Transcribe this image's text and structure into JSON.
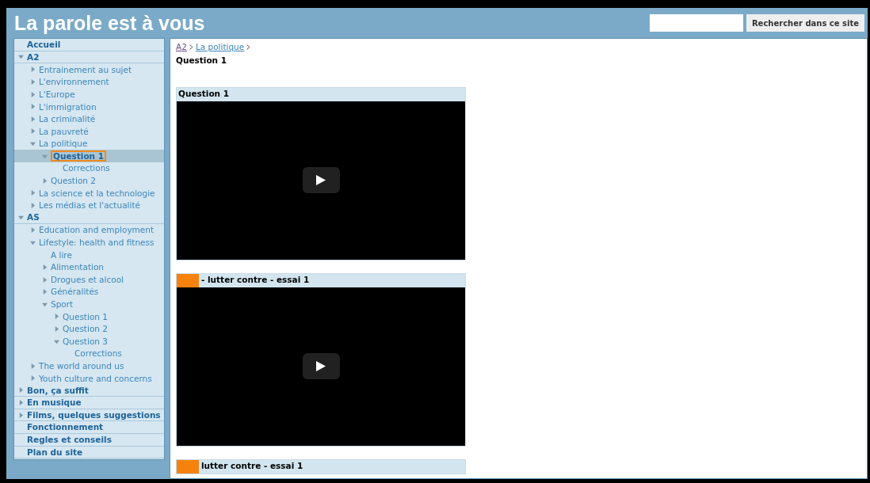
{
  "site_title": "La parole est à vous",
  "search": {
    "button": "Rechercher dans ce site"
  },
  "tree": [
    {
      "label": "Accueil",
      "selected": false
    },
    {
      "label": "A2",
      "selected": false,
      "expanded": true,
      "children": [
        {
          "label": "Entrainement au sujet",
          "selected": false,
          "expanded": false
        },
        {
          "label": "L'environnement",
          "selected": false,
          "expanded": false
        },
        {
          "label": "L'Europe",
          "selected": false,
          "expanded": false
        },
        {
          "label": "L'immigration",
          "selected": false,
          "expanded": false
        },
        {
          "label": "La criminalité",
          "selected": false,
          "expanded": false
        },
        {
          "label": "La pauvreté",
          "selected": false,
          "expanded": false
        },
        {
          "label": "La politique",
          "selected": false,
          "expanded": true,
          "children": [
            {
              "label": "Question 1",
              "selected": true,
              "expanded": true,
              "children": [
                {
                  "label": "Corrections",
                  "selected": false
                }
              ]
            },
            {
              "label": "Question 2",
              "selected": false,
              "expanded": false
            }
          ]
        },
        {
          "label": "La science et la technologie",
          "selected": false,
          "expanded": false
        },
        {
          "label": "Les médias et l'actualité",
          "selected": false,
          "expanded": false
        }
      ]
    },
    {
      "label": "AS",
      "selected": false,
      "expanded": true,
      "children": [
        {
          "label": "Education and employment",
          "selected": false,
          "expanded": false
        },
        {
          "label": "Lifestyle: health and fitness",
          "selected": false,
          "expanded": true,
          "children": [
            {
              "label": "A lire",
              "selected": false
            },
            {
              "label": "Alimentation",
              "selected": false,
              "expanded": false
            },
            {
              "label": "Drogues et alcool",
              "selected": false,
              "expanded": false
            },
            {
              "label": "Généralités",
              "selected": false,
              "expanded": false
            },
            {
              "label": "Sport",
              "selected": false,
              "expanded": true,
              "children": [
                {
                  "label": "Question 1",
                  "selected": false,
                  "expanded": false
                },
                {
                  "label": "Question 2",
                  "selected": false,
                  "expanded": false
                },
                {
                  "label": "Question 3",
                  "selected": false,
                  "expanded": true,
                  "children": [
                    {
                      "label": "Corrections",
                      "selected": false
                    }
                  ]
                }
              ]
            }
          ]
        },
        {
          "label": "The world around us",
          "selected": false,
          "expanded": false
        },
        {
          "label": "Youth culture and concerns",
          "selected": false,
          "expanded": false
        }
      ]
    },
    {
      "label": "Bon, ça suffit",
      "selected": false,
      "expanded": false
    },
    {
      "label": "En musique",
      "selected": false,
      "expanded": false
    },
    {
      "label": "Films, quelques suggestions",
      "selected": false,
      "expanded": false
    },
    {
      "label": "Fonctionnement",
      "selected": false
    },
    {
      "label": "Regles et conseils",
      "selected": false
    },
    {
      "label": "Plan du site",
      "selected": false
    }
  ],
  "breadcrumb": [
    {
      "label": "A2",
      "visited": true
    },
    {
      "label": "La politique",
      "visited": false
    }
  ],
  "page_title": "Question 1",
  "videos": [
    {
      "title": "Question 1",
      "flagged": false
    },
    {
      "title": "- lutter contre - essai 1",
      "flagged": true
    },
    {
      "title": "lutter contre - essai 1",
      "flagged": true
    }
  ]
}
